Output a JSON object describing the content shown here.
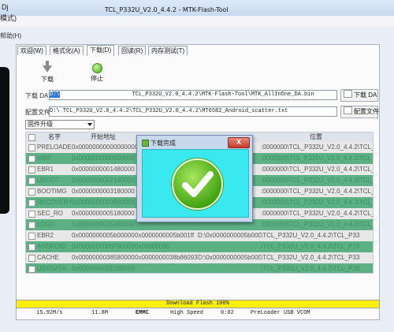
{
  "window": {
    "left_fragment": "Dj",
    "title": "TCL_P332U_V2.0_4.4.2 - MTK-Flash-Tool"
  },
  "menu": {
    "mode_label": "模式)",
    "help_label": "帮助(H)"
  },
  "tabs": [
    {
      "label": "欢迎(W)"
    },
    {
      "label": "格式化(A)"
    },
    {
      "label": "下载(D)"
    },
    {
      "label": "回读(R)"
    },
    {
      "label": "内存测试(T)"
    }
  ],
  "toolbar": {
    "download_label": "下载",
    "stop_label": "停止"
  },
  "download_agent": {
    "label": "下载 DA",
    "path_selected": "D:\\",
    "path_rest": "TCL_P332U_V2.0_4.4.2\\MTK-Flash-Tool\\MTK_AllInOne_DA.bin",
    "button_label": "下载 DA"
  },
  "scatter": {
    "label": "配置文件",
    "path": "D:\\                    TCL_P332U_V2.0_4.4.2\\TCL_P332U_V2.0_4.4.2\\MT6582_Android_scatter.txt",
    "button_label": "配置文件"
  },
  "mode_select": {
    "value": "固件升级"
  },
  "table": {
    "headers": [
      "名字",
      "开始地址",
      "",
      "",
      "位置"
    ],
    "rows": [
      {
        "style": "w",
        "name": "PRELOADER",
        "start": "0x0000000000000000",
        "c3": "0",
        "c4": "",
        "location": ":0000000\\TCL_P332U_V2.0_4.4.2\\TCL_P33"
      },
      {
        "style": "g",
        "name": "MBR",
        "start": "0x0000000000000000",
        "c3": "",
        "c4": "",
        "location": ":0000000\\TCL_P332U_V2.0_4.4.2\\TCL_P33"
      },
      {
        "style": "w",
        "name": "EBR1",
        "start": "0x0000000001480000",
        "c3": "",
        "c4": "",
        "location": ":0000000\\TCL_P332U_V2.0_4.4.2\\TCL_P33"
      },
      {
        "style": "g",
        "name": "UBOOT",
        "start": "0x0000000002140000",
        "c3": "",
        "c4": "",
        "location": ":0000000\\TCL_P332U_V2.0_4.4.2\\TCL_P33"
      },
      {
        "style": "w",
        "name": "BOOTIMG",
        "start": "0x0000000003180000",
        "c3": "",
        "c4": "",
        "location": ":0000000\\TCL_P332U_V2.0_4.4.2\\TCL_P33"
      },
      {
        "style": "g",
        "name": "RECOVERY",
        "start": "0x0000000003B80000",
        "c3": "",
        "c4": "",
        "location": ":0000000\\TCL_P332U_V2.0_4.4.2\\TCL_P33"
      },
      {
        "style": "w",
        "name": "SEC_RO",
        "start": "0x0000000005180000",
        "c3": "",
        "c4": "",
        "location": ":0000000\\TCL_P332U_V2.0_4.4.2\\TCL_P33"
      },
      {
        "style": "g",
        "name": "LOGO",
        "start": "0x0000000005A80000",
        "c3": "",
        "c4": "",
        "location": ":0000000\\TCL_P332U_V2.0_4.4.2\\TCL_P33"
      },
      {
        "style": "w",
        "name": "EBR2",
        "start": "0x0000000005b00000",
        "c3": "0x0000000005b001ff",
        "c4": "D:\\0x0000000005b00000",
        "location": "\\TCL_P332U_V2.0_4.4.2\\TCL_P33"
      },
      {
        "style": "g",
        "name": "ANDROID",
        "start": "0x0000000005F80000",
        "c3": "0x00000000",
        "c4": "",
        "location": "\\TCL_P332U_V2.0_4.4.2\\TCL_P33"
      },
      {
        "style": "w",
        "name": "CACHE",
        "start": "0x0000000038580000",
        "c3": "0x0000000038b86093",
        "c4": "D:\\0x0000000005b00000",
        "location": "\\TCL_P332U_V2.0_4.4.2\\TCL_P33"
      },
      {
        "style": "g",
        "name": "USRDATA",
        "start": "0x000000005E580000",
        "c3": "",
        "c4": "",
        "location": "\\TCL_P332U_V2.0_4.4.2\\TCL_P33"
      }
    ]
  },
  "dialog": {
    "title": "下载完成",
    "close_symbol": "X"
  },
  "progress": {
    "percent": 100,
    "text": "Download Flash 100%"
  },
  "status": {
    "speed": "15.92M/s",
    "size": "11.8M",
    "storage": "EMMC",
    "usb_speed": "High Speed",
    "time": "0:02",
    "port": "PreLoader USB VCOM"
  },
  "colors": {
    "row_green": "#5cb184",
    "dialog_content": "#3ae9ef",
    "progress_fill": "#ffef00",
    "success_green": "#45a414"
  }
}
